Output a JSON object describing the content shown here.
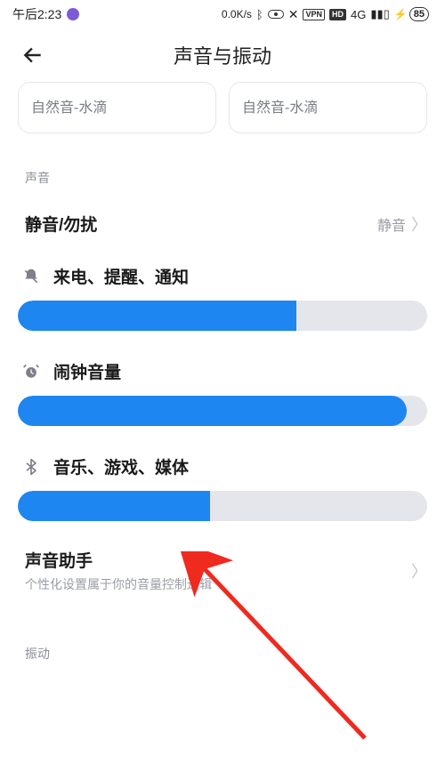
{
  "status_bar": {
    "time": "午后2:23",
    "net_speed": "0.0K/s",
    "vpn_label": "VPN",
    "hd_label": "HD",
    "network_type": "4G",
    "battery_text": "85"
  },
  "header": {
    "title": "声音与振动"
  },
  "ringtone_cards": {
    "left": "自然音-水滴",
    "right": "自然音-水滴"
  },
  "sections": {
    "sound_label": "声音",
    "vibration_label": "振动"
  },
  "rows": {
    "silent_dnd": {
      "title": "静音/勿扰",
      "value": "静音"
    },
    "assistant": {
      "title": "声音助手",
      "subtitle": "个性化设置属于你的音量控制逻辑"
    }
  },
  "sliders": {
    "ring": {
      "label": "来电、提醒、通知",
      "percent": 68
    },
    "alarm": {
      "label": "闹钟音量",
      "percent": 95
    },
    "media": {
      "label": "音乐、游戏、媒体",
      "percent": 47
    }
  }
}
